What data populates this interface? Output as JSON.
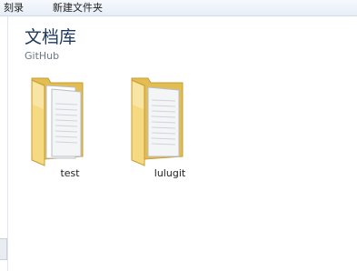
{
  "toolbar": {
    "burn_label": "刻录",
    "new_folder_label": "新建文件夹"
  },
  "library": {
    "title": "文档库",
    "subtitle": "GitHub"
  },
  "items": [
    {
      "name": "test",
      "icon": "folder-icon"
    },
    {
      "name": "lulugit",
      "icon": "folder-icon"
    }
  ],
  "colors": {
    "folder_back": "#e6c35c",
    "folder_front": "#f7de8a",
    "title_color": "#1e395b"
  }
}
